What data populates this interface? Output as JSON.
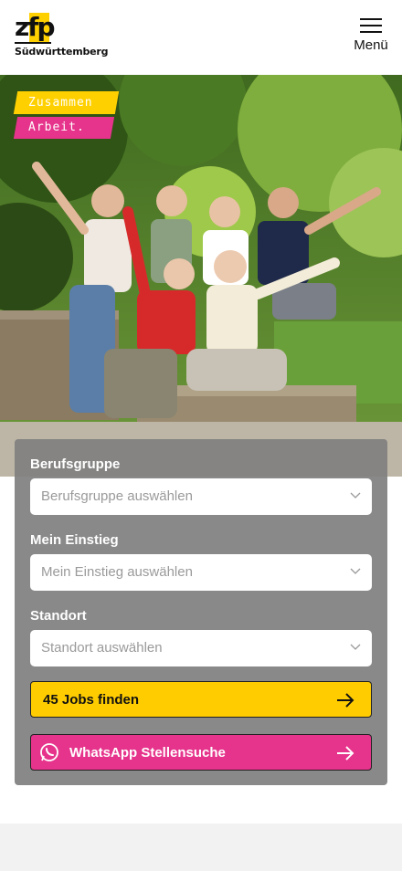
{
  "header": {
    "logo_letters": "zfp",
    "logo_subtitle": "Südwürttemberg",
    "menu_label": "Menü"
  },
  "hero": {
    "tag_line_1": "Zusammen",
    "tag_line_2": "Arbeit."
  },
  "search": {
    "fields": [
      {
        "label": "Berufsgruppe",
        "placeholder": "Berufsgruppe auswählen"
      },
      {
        "label": "Mein Einstieg",
        "placeholder": "Mein Einstieg auswählen"
      },
      {
        "label": "Standort",
        "placeholder": "Standort auswählen"
      }
    ],
    "find_button": "45 Jobs finden",
    "whatsapp_button": "WhatsApp Stellensuche"
  },
  "colors": {
    "brand_yellow": "#ffcc00",
    "brand_pink": "#e6338b",
    "panel_gray": "#808080"
  },
  "icons": [
    "hamburger-menu-icon",
    "chevron-down-icon",
    "arrow-right-icon",
    "whatsapp-icon"
  ]
}
